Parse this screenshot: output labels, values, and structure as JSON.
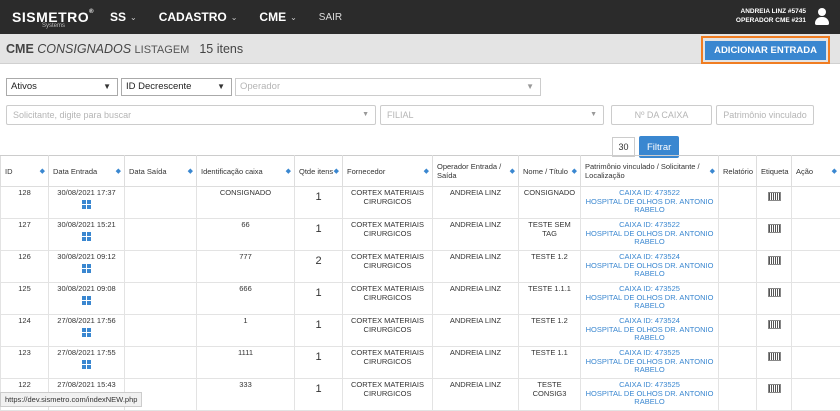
{
  "header": {
    "logo": "SISMETRO",
    "logo_reg": "®",
    "logo_sub": "Systems",
    "nav": [
      {
        "label": "SS",
        "chevron": "⌄"
      },
      {
        "label": "CADASTRO",
        "chevron": "⌄"
      },
      {
        "label": "CME",
        "chevron": "⌄"
      },
      {
        "label": "SAIR",
        "chevron": ""
      }
    ],
    "user_line1": "ANDREIA LINZ #5745",
    "user_line2": "OPERADOR CME #231"
  },
  "page": {
    "title_bold": "CME",
    "title_italic": "CONSIGNADOS",
    "title_list": "LISTAGEM",
    "count": "15 itens",
    "add_button": "ADICIONAR ENTRADA"
  },
  "filters": {
    "status": "Ativos",
    "order": "ID Decrescente",
    "operator_placeholder": "Operador",
    "requester_placeholder": "Solicitante, digite para buscar",
    "branch_placeholder": "FILIAL",
    "box_placeholder": "Nº DA CAIXA",
    "asset_placeholder": "Patrimônio vinculado",
    "page_size": "30",
    "filter_button": "Filtrar"
  },
  "table": {
    "headers": [
      "ID",
      "Data Entrada",
      "Data Saída",
      "Identificação caixa",
      "Qtde itens",
      "Fornecedor",
      "Operador Entrada / Saída",
      "Nome / Título",
      "Patrimônio vinculado / Solicitante / Localização",
      "Relatório",
      "Etiqueta",
      "Ação"
    ],
    "rows": [
      {
        "id": "128",
        "entry": "30/08/2021 17:37",
        "exit": "",
        "box": "CONSIGNADO",
        "qty": "1",
        "supplier": "CORTEX MATERIAIS CIRURGICOS",
        "operator": "ANDREIA LINZ",
        "name": "CONSIGNADO",
        "asset": "CAIXA ID: 473522",
        "location": "HOSPITAL DE OLHOS DR. ANTONIO RABELO"
      },
      {
        "id": "127",
        "entry": "30/08/2021 15:21",
        "exit": "",
        "box": "66",
        "qty": "1",
        "supplier": "CORTEX MATERIAIS CIRURGICOS",
        "operator": "ANDREIA LINZ",
        "name": "TESTE SEM TAG",
        "asset": "CAIXA ID: 473522",
        "location": "HOSPITAL DE OLHOS DR. ANTONIO RABELO"
      },
      {
        "id": "126",
        "entry": "30/08/2021 09:12",
        "exit": "",
        "box": "777",
        "qty": "2",
        "supplier": "CORTEX MATERIAIS CIRURGICOS",
        "operator": "ANDREIA LINZ",
        "name": "TESTE 1.2",
        "asset": "CAIXA ID: 473524",
        "location": "HOSPITAL DE OLHOS DR. ANTONIO RABELO"
      },
      {
        "id": "125",
        "entry": "30/08/2021 09:08",
        "exit": "",
        "box": "666",
        "qty": "1",
        "supplier": "CORTEX MATERIAIS CIRURGICOS",
        "operator": "ANDREIA LINZ",
        "name": "TESTE 1.1.1",
        "asset": "CAIXA ID: 473525",
        "location": "HOSPITAL DE OLHOS DR. ANTONIO RABELO"
      },
      {
        "id": "124",
        "entry": "27/08/2021 17:56",
        "exit": "",
        "box": "1",
        "qty": "1",
        "supplier": "CORTEX MATERIAIS CIRURGICOS",
        "operator": "ANDREIA LINZ",
        "name": "TESTE 1.2",
        "asset": "CAIXA ID: 473524",
        "location": "HOSPITAL DE OLHOS DR. ANTONIO RABELO"
      },
      {
        "id": "123",
        "entry": "27/08/2021 17:55",
        "exit": "",
        "box": "1111",
        "qty": "1",
        "supplier": "CORTEX MATERIAIS CIRURGICOS",
        "operator": "ANDREIA LINZ",
        "name": "TESTE 1.1",
        "asset": "CAIXA ID: 473525",
        "location": "HOSPITAL DE OLHOS DR. ANTONIO RABELO"
      },
      {
        "id": "122",
        "entry": "27/08/2021 15:43",
        "exit": "",
        "box": "333",
        "qty": "1",
        "supplier": "CORTEX MATERIAIS CIRURGICOS",
        "operator": "ANDREIA LINZ",
        "name": "TESTE CONSIG3",
        "asset": "CAIXA ID: 473525",
        "location": "HOSPITAL DE OLHOS DR. ANTONIO RABELO"
      }
    ]
  },
  "statusbar": "https://dev.sismetro.com/indexNEW.php",
  "colors": {
    "accent": "#3a87d0",
    "highlight": "#f07d22",
    "topbar": "#2b2b2b"
  }
}
